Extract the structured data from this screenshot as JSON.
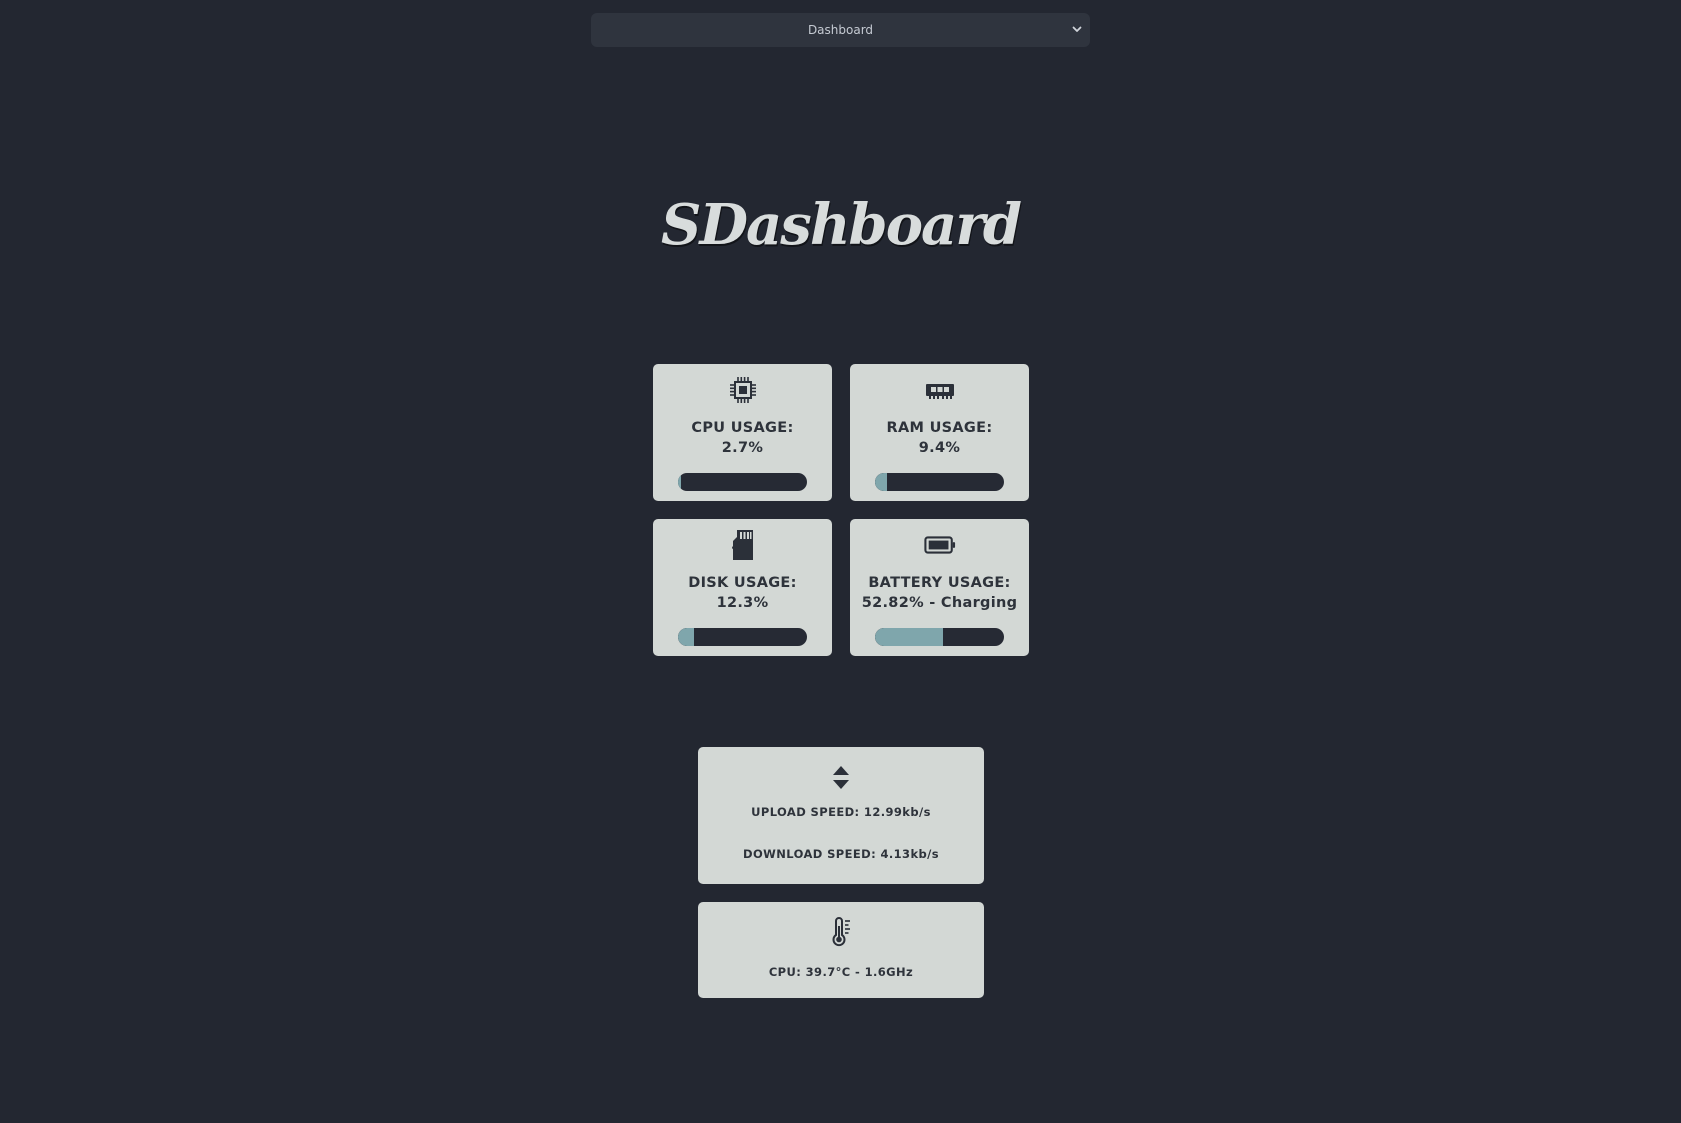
{
  "page_select": {
    "selected": "Dashboard"
  },
  "title": "SDashboard",
  "cards": {
    "cpu": {
      "icon": "cpu-chip-icon",
      "label": "CPU USAGE:",
      "value": "2.7%",
      "fill": 0.027
    },
    "ram": {
      "icon": "ram-module-icon",
      "label": "RAM USAGE:",
      "value": "9.4%",
      "fill": 0.094
    },
    "disk": {
      "icon": "sd-card-icon",
      "label": "DISK USAGE:",
      "value": "12.3%",
      "fill": 0.123
    },
    "battery": {
      "icon": "battery-icon",
      "label": "BATTERY USAGE:",
      "value": "52.82% - Charging",
      "fill": 0.5282
    }
  },
  "network": {
    "icon": "sort-arrows-icon",
    "upload": "UPLOAD SPEED: 12.99kb/s",
    "download": "DOWNLOAD SPEED: 4.13kb/s"
  },
  "temperature": {
    "icon": "thermometer-icon",
    "text": "CPU: 39.7°C - 1.6GHz"
  },
  "colors": {
    "background": "#232731",
    "card": "#d3d8d5",
    "bar_track": "#262a34",
    "bar_fill": "#7fa6ac"
  }
}
